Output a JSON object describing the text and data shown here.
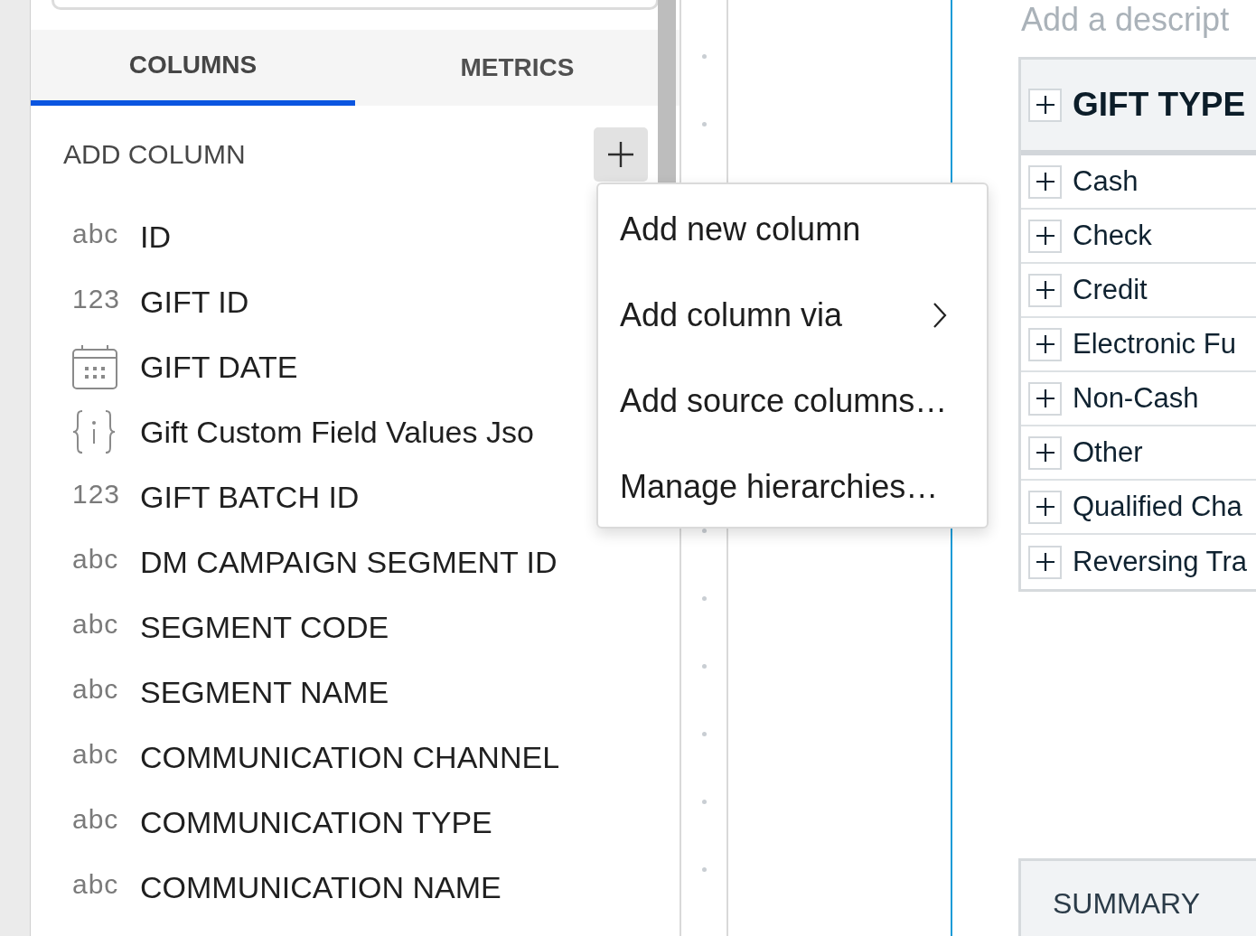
{
  "left_panel": {
    "tabs": [
      {
        "label": "COLUMNS",
        "selected": true
      },
      {
        "label": "METRICS",
        "selected": false
      }
    ],
    "add_column": {
      "label": "ADD COLUMN"
    },
    "columns": [
      {
        "kind": "text",
        "type_label": "abc",
        "name": "ID"
      },
      {
        "kind": "number",
        "type_label": "123",
        "name": "GIFT ID"
      },
      {
        "kind": "date",
        "name": "GIFT DATE"
      },
      {
        "kind": "json",
        "name": "Gift Custom Field Values Jso"
      },
      {
        "kind": "number",
        "type_label": "123",
        "name": "GIFT BATCH ID"
      },
      {
        "kind": "text",
        "type_label": "abc",
        "name": "DM CAMPAIGN SEGMENT ID"
      },
      {
        "kind": "text",
        "type_label": "abc",
        "name": "SEGMENT CODE"
      },
      {
        "kind": "text",
        "type_label": "abc",
        "name": "SEGMENT NAME"
      },
      {
        "kind": "text",
        "type_label": "abc",
        "name": "COMMUNICATION CHANNEL"
      },
      {
        "kind": "text",
        "type_label": "abc",
        "name": "COMMUNICATION TYPE"
      },
      {
        "kind": "text",
        "type_label": "abc",
        "name": "COMMUNICATION NAME"
      }
    ]
  },
  "menu": {
    "items": [
      {
        "kind": "action",
        "label": "Add new column"
      },
      {
        "kind": "submenu",
        "label": "Add column via"
      },
      {
        "kind": "action",
        "label": "Add source columns…"
      },
      {
        "kind": "action",
        "label": "Manage hierarchies…"
      }
    ]
  },
  "report": {
    "description": {
      "placeholder": "Add a descript"
    },
    "table": {
      "header": {
        "label": "GIFT TYPE",
        "expanded": false
      },
      "rows": [
        {
          "label": "Cash",
          "expanded": false
        },
        {
          "label": "Check",
          "expanded": false
        },
        {
          "label": "Credit",
          "expanded": false
        },
        {
          "label": "Electronic Fu",
          "expanded": false
        },
        {
          "label": "Non-Cash",
          "expanded": false
        },
        {
          "label": "Other",
          "expanded": false
        },
        {
          "label": "Qualified Cha",
          "expanded": false
        },
        {
          "label": "Reversing Tra",
          "expanded": false
        }
      ]
    },
    "summary": {
      "label": "SUMMARY"
    }
  }
}
